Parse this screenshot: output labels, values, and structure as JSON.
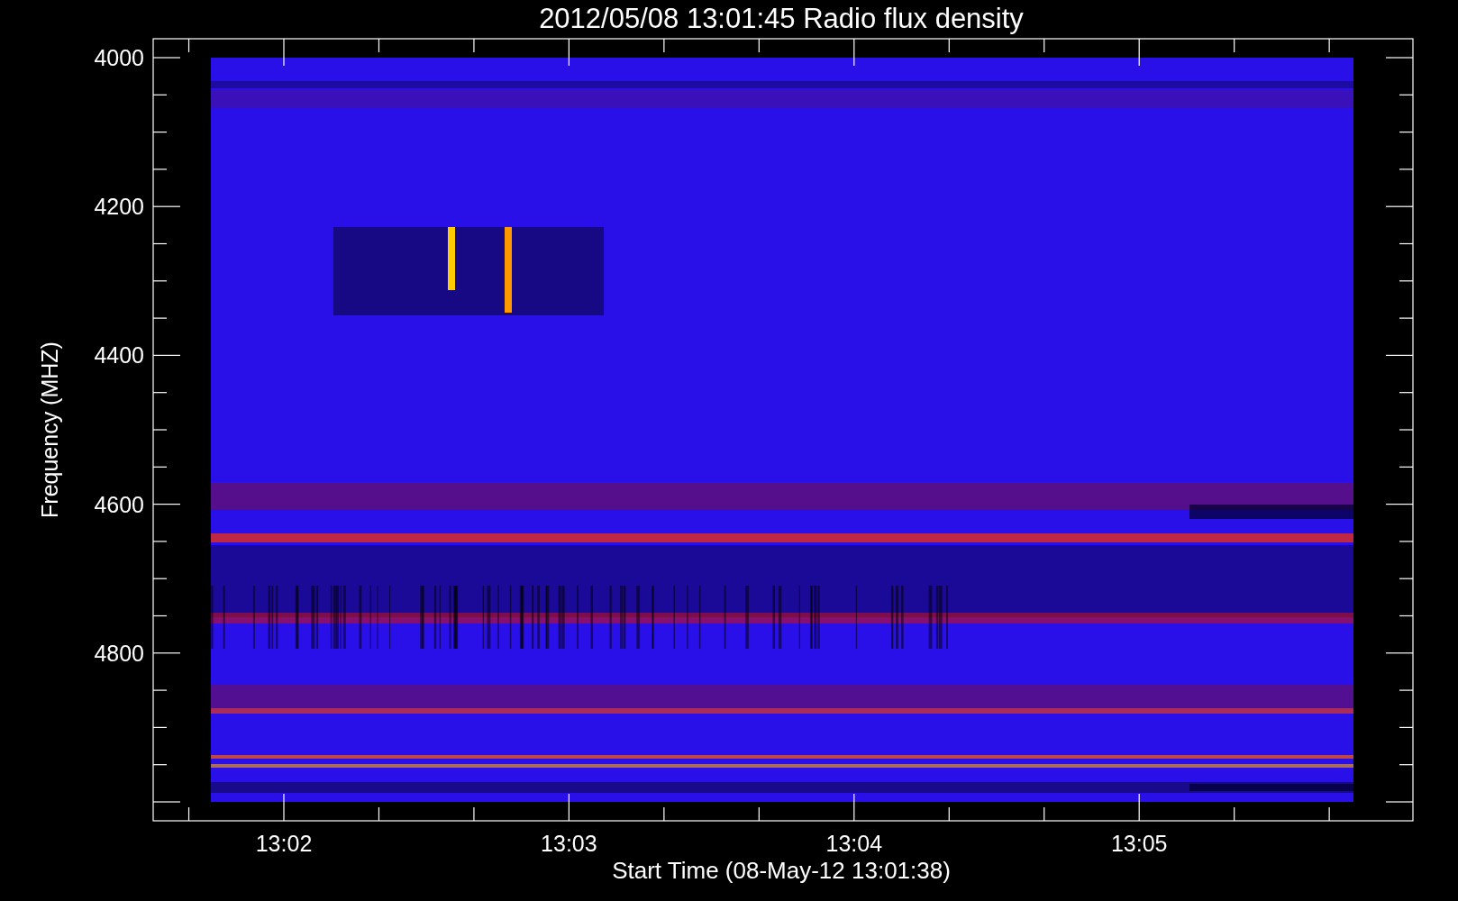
{
  "title": "2012/05/08 13:01:45 Radio flux density",
  "x_axis": {
    "label": "Start Time (08-May-12 13:01:38)",
    "ticks": [
      "13:02",
      "13:03",
      "13:04",
      "13:05"
    ]
  },
  "y_axis": {
    "label": "Frequency (MHZ)",
    "ticks": [
      "4000",
      "4200",
      "4400",
      "4600",
      "4800"
    ]
  }
}
